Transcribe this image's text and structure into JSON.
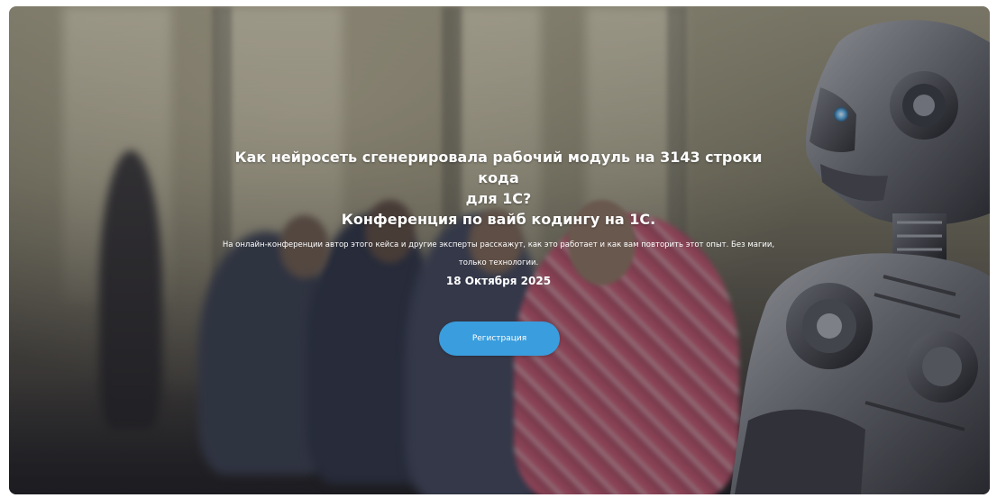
{
  "hero": {
    "title_lines": [
      "Как нейросеть сгенерировала рабочий модуль на 3143 строки кода",
      "для 1С?",
      "Конференция по вайб кодингу на 1С."
    ],
    "description": "На онлайн-конференции автор этого кейса и другие эксперты расскажут, как это работает и как вам повторить этот опыт. Без магии, только технологии.",
    "date": "18 Октября 2025",
    "register_button_label": "Регистрация",
    "colors": {
      "button": "#3a9ddd",
      "text": "#ffffff"
    }
  }
}
